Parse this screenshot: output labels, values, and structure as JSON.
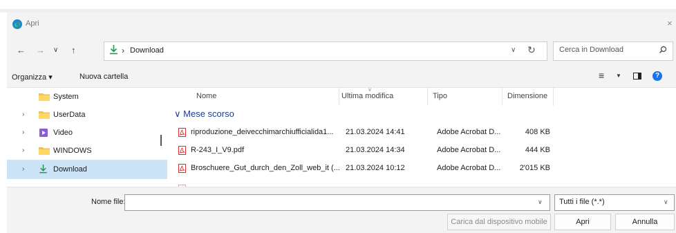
{
  "window": {
    "title": "Apri",
    "close_glyph": "×"
  },
  "address": {
    "back_glyph": "←",
    "forward_glyph": "→",
    "recent_glyph": "∨",
    "up_glyph": "↑",
    "breadcrumb_separator": "›",
    "breadcrumb": "Download",
    "history_glyph": "∨",
    "refresh_glyph": "↻"
  },
  "search": {
    "placeholder": "Cerca in Download"
  },
  "toolbar": {
    "organize_label": "Organizza ▾",
    "new_folder_label": "Nuova cartella",
    "view_glyph": "≡",
    "view_caret": "▼",
    "help_glyph": "?"
  },
  "nav_pane": {
    "items": [
      {
        "label": "System",
        "icon": "folder-icon",
        "expandable": false,
        "selected": false
      },
      {
        "label": "UserData",
        "icon": "folder-icon",
        "expandable": true,
        "selected": false
      },
      {
        "label": "Video",
        "icon": "video-folder-icon",
        "expandable": true,
        "selected": false
      },
      {
        "label": "WINDOWS",
        "icon": "folder-icon",
        "expandable": true,
        "selected": false
      },
      {
        "label": "Download",
        "icon": "download-icon",
        "expandable": true,
        "selected": true
      }
    ],
    "chevron_glyph": "›"
  },
  "file_list": {
    "columns": {
      "name": "Nome",
      "modified": "Ultima modifica",
      "type": "Tipo",
      "size": "Dimensione"
    },
    "sort_glyph": "∨",
    "group_label": "Mese scorso",
    "group_glyph": "∨",
    "rows": [
      {
        "name": "riproduzione_deivecchimarchiufficialida1...",
        "modified": "21.03.2024 14:41",
        "type": "Adobe Acrobat D...",
        "size": "408 KB"
      },
      {
        "name": "R-243_I_V9.pdf",
        "modified": "21.03.2024 14:34",
        "type": "Adobe Acrobat D...",
        "size": "444 KB"
      },
      {
        "name": "Broschuere_Gut_durch_den_Zoll_web_it (...",
        "modified": "21.03.2024 10:12",
        "type": "Adobe Acrobat D...",
        "size": "2'015 KB"
      }
    ]
  },
  "bottom": {
    "filename_label": "Nome file:",
    "filename_value": "",
    "filter_value": "Tutti i file (*.*)",
    "dropdown_glyph": "∨",
    "mobile_button": "Carica dal dispositivo mobile",
    "open_button": "Apri",
    "cancel_button": "Annulla"
  },
  "colors": {
    "selection": "#cce4f7",
    "group_heading": "#1a3e8f",
    "pdf_red": "#d32f2f",
    "help_blue": "#1a73e8"
  }
}
